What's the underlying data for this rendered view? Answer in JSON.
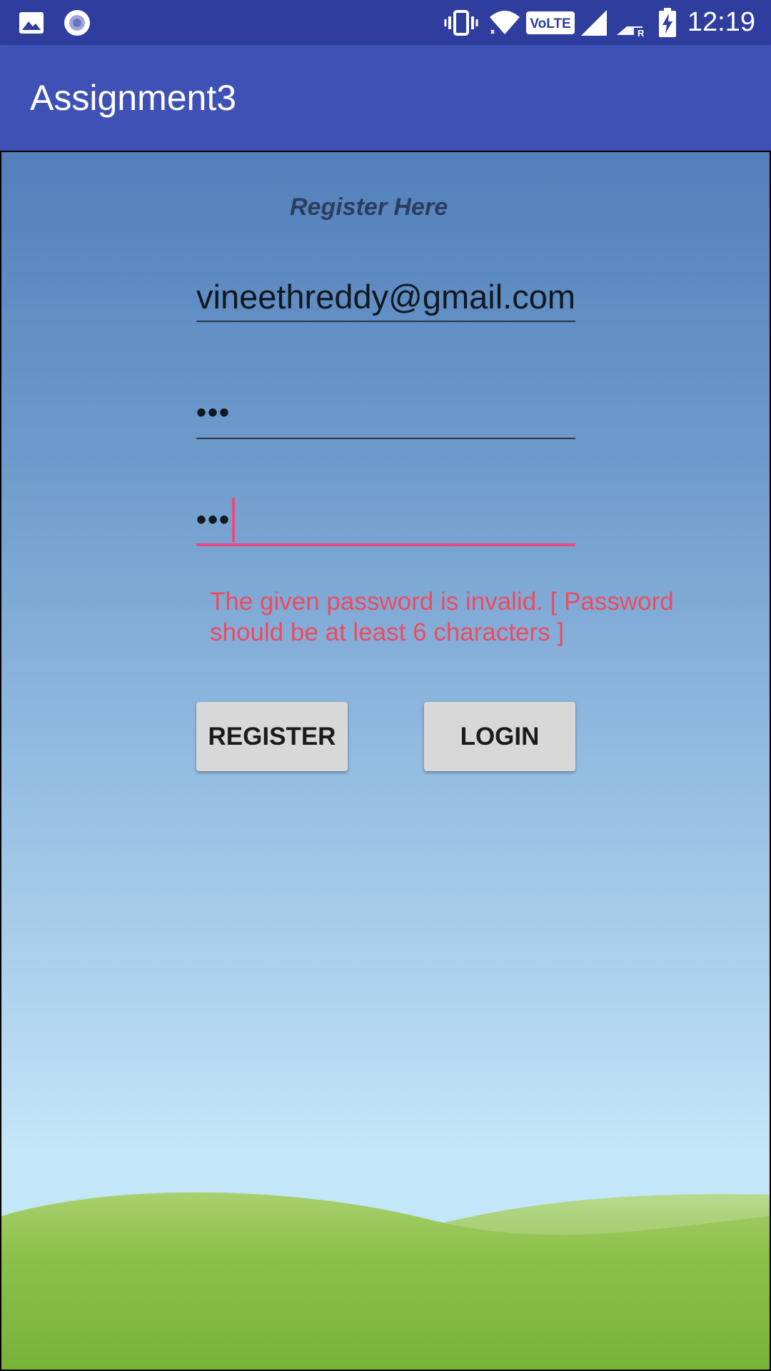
{
  "status_bar": {
    "time": "12:19",
    "icons": [
      "image-icon",
      "record-icon",
      "vibrate-icon",
      "wifi-icon",
      "volte-icon",
      "signal-icon",
      "signal-roaming-icon",
      "battery-charging-icon"
    ],
    "volte_label": "VoLTE",
    "roaming_label": "R"
  },
  "app_bar": {
    "title": "Assignment3",
    "color": "#3f51b5"
  },
  "form": {
    "heading": "Register Here",
    "email_value": "vineethreddy@gmail.com",
    "password_value": "•••",
    "confirm_password_value": "•••",
    "error_message": "The given password is invalid. [ Password should be at least 6 characters ]",
    "error_color": "#ef4a5e",
    "focus_color": "#e94a84"
  },
  "buttons": {
    "register_label": "REGISTER",
    "login_label": "LOGIN"
  }
}
